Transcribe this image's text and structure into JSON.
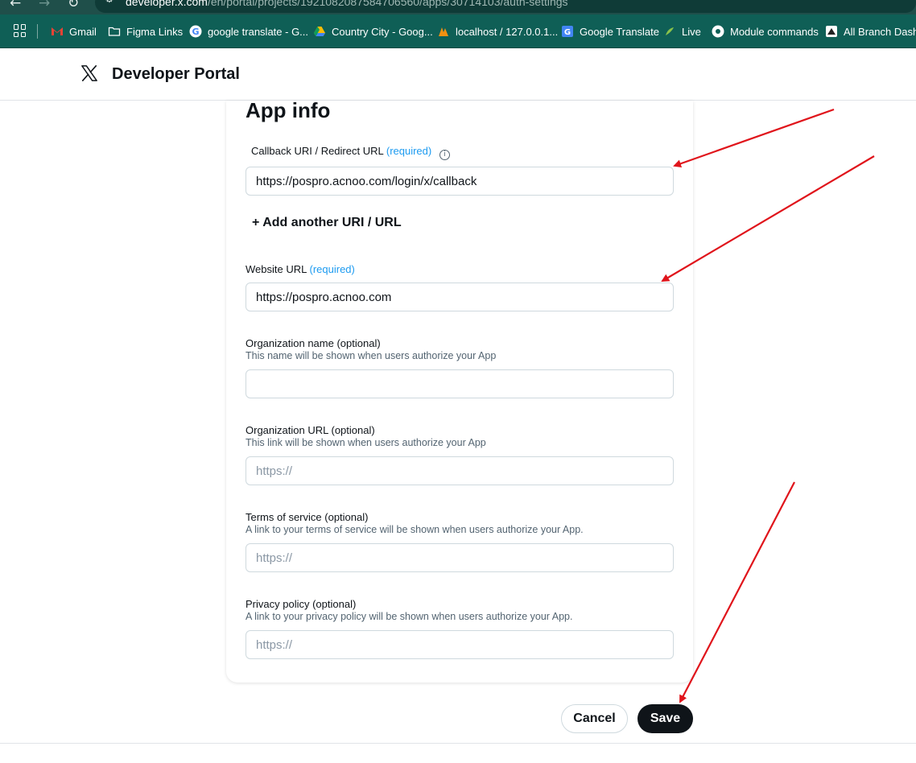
{
  "browser": {
    "back_icon": "arrow-left-icon",
    "forward_icon": "arrow-right-icon",
    "reload_icon": "reload-icon",
    "url_host": "developer.x.com",
    "url_path": "/en/portal/projects/1921082087584706560/apps/30714103/auth-settings"
  },
  "bookmarks": [
    {
      "label": "Gmail",
      "color": "#ea4335"
    },
    {
      "label": "Figma Links",
      "color": "#ffffff"
    },
    {
      "label": "google translate - G...",
      "color": "#4285f4"
    },
    {
      "label": "Country City - Goog...",
      "color": "#fbbc04"
    },
    {
      "label": "localhost / 127.0.0.1...",
      "color": "#f29111"
    },
    {
      "label": "Google Translate",
      "color": "#4285f4"
    },
    {
      "label": "Live",
      "color": "#8bc34a"
    },
    {
      "label": "Module commands",
      "color": "#ffffff"
    },
    {
      "label": "All Branch Dashbo",
      "color": "#ffffff"
    }
  ],
  "header": {
    "title": "Developer Portal"
  },
  "form": {
    "title": "App info",
    "callback": {
      "label": "Callback URI / Redirect URL",
      "required": "(required)",
      "value": "https://pospro.acnoo.com/login/x/callback"
    },
    "add_uri_label": "+ Add another URI / URL",
    "website": {
      "label": "Website URL",
      "required": "(required)",
      "value": "https://pospro.acnoo.com"
    },
    "org_name": {
      "label": "Organization name",
      "optional": "(optional)",
      "help": "This name will be shown when users authorize your App",
      "value": ""
    },
    "org_url": {
      "label": "Organization URL",
      "optional": "(optional)",
      "help": "This link will be shown when users authorize your App",
      "placeholder": "https://"
    },
    "terms": {
      "label": "Terms of service",
      "optional": "(optional)",
      "help": "A link to your terms of service will be shown when users authorize your App.",
      "placeholder": "https://"
    },
    "privacy": {
      "label": "Privacy policy",
      "optional": "(optional)",
      "help": "A link to your privacy policy will be shown when users authorize your App.",
      "placeholder": "https://"
    }
  },
  "actions": {
    "cancel_label": "Cancel",
    "save_label": "Save"
  },
  "colors": {
    "accent": "#1d9bf0",
    "annotation_arrow": "#e0141b"
  }
}
